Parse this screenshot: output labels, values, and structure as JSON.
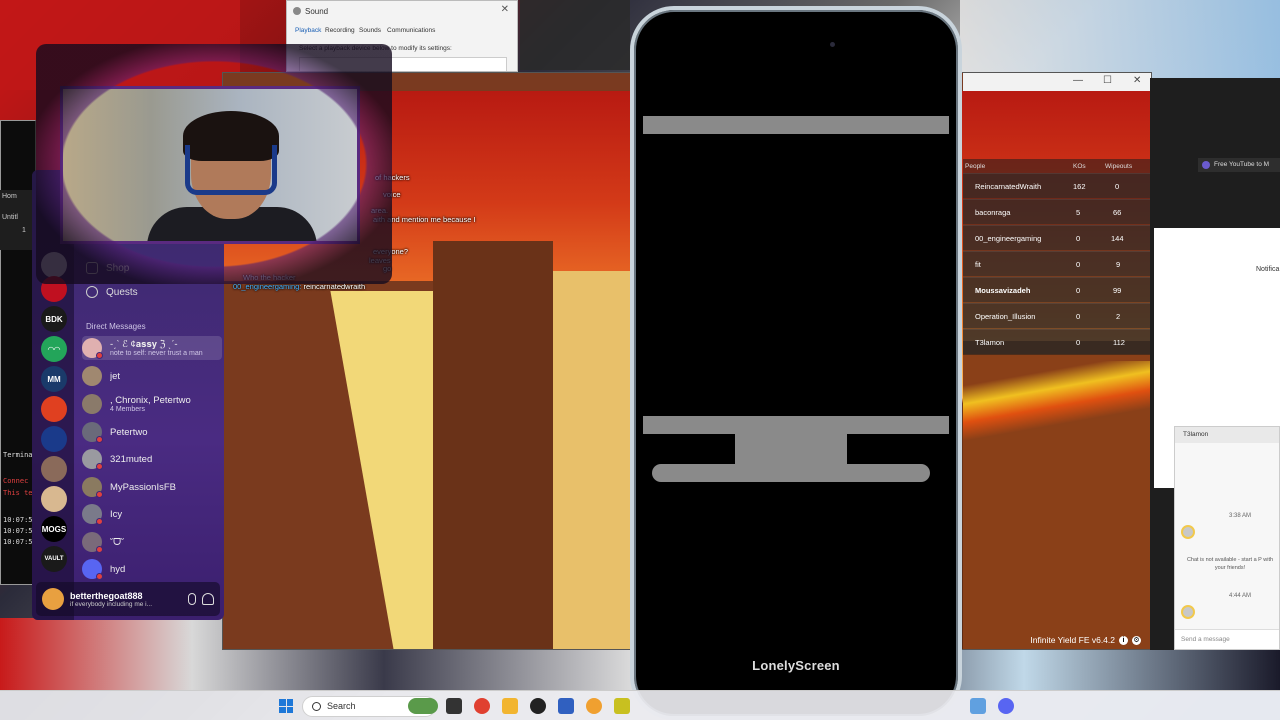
{
  "terminal": {
    "title": "Terminals",
    "lines": [
      "Connec",
      "This te",
      "10:07:5",
      "10:07:5",
      "10:07:5"
    ]
  },
  "left_browser": {
    "home_label": "Hom",
    "item_label": "Untitl",
    "count": "1"
  },
  "discord": {
    "nav": {
      "shop": "Shop",
      "quests": "Quests"
    },
    "dm_header": "Direct Messages",
    "dms": [
      {
        "name": "-ˏˋ ℰ ¢𝐚𝐬𝐬𝐲 ℨ ˎˊ-",
        "sub": "note to self: never trust a man",
        "color": "#e0b0b0",
        "status": "#e04040"
      },
      {
        "name": "jet",
        "sub": "",
        "color": "#a08870",
        "status": ""
      },
      {
        "name": ", Chronix, Petertwo",
        "sub": "4 Members",
        "color": "#8a7a6a",
        "status": ""
      },
      {
        "name": "Petertwo",
        "sub": "",
        "color": "#6a6a7a",
        "status": "#e04040"
      },
      {
        "name": "321muted",
        "sub": "",
        "color": "#9a9aa0",
        "status": "#e04040"
      },
      {
        "name": "MyPassionIsFB",
        "sub": "",
        "color": "#8a7a60",
        "status": "#e04040"
      },
      {
        "name": "Icy",
        "sub": "",
        "color": "#7a7a8a",
        "status": "#e04040"
      },
      {
        "name": "˘ᗜ˘",
        "sub": "",
        "color": "#7a6a7a",
        "status": "#e04040"
      },
      {
        "name": "hyd",
        "sub": "",
        "color": "#5865f2",
        "status": "#e04040"
      }
    ],
    "guilds": [
      {
        "label": "",
        "color": "#c0c0c8"
      },
      {
        "label": "",
        "color": "#c01020"
      },
      {
        "label": "BDK",
        "color": "#1a1a1a"
      },
      {
        "label": "◠◠",
        "color": "#23a55a"
      },
      {
        "label": "MM",
        "color": "#1a3a6a"
      },
      {
        "label": "",
        "color": "#e04020"
      },
      {
        "label": "",
        "color": "#1a3a8a"
      },
      {
        "label": "",
        "color": "#8a6a5a"
      },
      {
        "label": "",
        "color": "#d8b890"
      },
      {
        "label": "MOGS",
        "color": "#000000"
      },
      {
        "label": "VAULT",
        "color": "#1a1a1a"
      }
    ],
    "user": {
      "name": "betterthegoat888",
      "status": "if everybody including me i..."
    }
  },
  "sound_dialog": {
    "title": "Sound",
    "close": "✕",
    "tabs": [
      "Playback",
      "Recording",
      "Sounds",
      "Communications"
    ],
    "description": "Select a playback device below to modify its settings:"
  },
  "game": {
    "window_controls": [
      "—",
      "☐",
      "✕"
    ],
    "chat": [
      {
        "user": "",
        "text": "of hackers"
      },
      {
        "user": "",
        "text": "voice"
      },
      {
        "user": "",
        "text": "area."
      },
      {
        "user": "",
        "text": "aith and mention me because I"
      },
      {
        "user": "",
        "text": "everyone?"
      },
      {
        "user": "",
        "text": "go"
      },
      {
        "user": "",
        "text": "leaves"
      },
      {
        "user": "",
        "text": "Who the hacker"
      },
      {
        "user": "00_engineergaming:",
        "text": "reincarnatedwraith"
      }
    ],
    "leaderboard": {
      "headers": [
        "People",
        "KOs",
        "Wipeouts"
      ],
      "rows": [
        {
          "name": "ReincarnatedWraith",
          "kos": "162",
          "wipeouts": "0"
        },
        {
          "name": "baconraga",
          "kos": "5",
          "wipeouts": "66"
        },
        {
          "name": "00_engineergaming",
          "kos": "0",
          "wipeouts": "144"
        },
        {
          "name": "fit",
          "kos": "0",
          "wipeouts": "9"
        },
        {
          "name": "Moussavizadeh",
          "kos": "0",
          "wipeouts": "99"
        },
        {
          "name": "Operation_Illusion",
          "kos": "0",
          "wipeouts": "2"
        },
        {
          "name": "T3lamon",
          "kos": "0",
          "wipeouts": "112"
        }
      ]
    },
    "infinite_yield": "Infinite Yield FE v6.4.2"
  },
  "phone": {
    "brand": "LonelyScreen"
  },
  "browser": {
    "tab_label": "Free YouTube to M",
    "notif_label": "Notifica"
  },
  "roblox_chat": {
    "title": "T3lamon",
    "time1": "3:38 AM",
    "time2": "4:44 AM",
    "note": "Chat is not available - start a P with your friends!",
    "placeholder": "Send a message"
  },
  "taskbar": {
    "search_label": "Search",
    "apps": [
      {
        "name": "widgets",
        "color": "#5a9a4a"
      },
      {
        "name": "task-view",
        "color": "#333333"
      },
      {
        "name": "chrome",
        "color": "#e04030"
      },
      {
        "name": "file-explorer",
        "color": "#f2b530"
      },
      {
        "name": "roblox-studio",
        "color": "#222222"
      },
      {
        "name": "app",
        "color": "#3060c0"
      },
      {
        "name": "app2",
        "color": "#f0a030"
      },
      {
        "name": "app3",
        "color": "#c8c020"
      },
      {
        "name": "app4",
        "color": "#60a0e0"
      },
      {
        "name": "discord",
        "color": "#5865f2"
      }
    ]
  }
}
